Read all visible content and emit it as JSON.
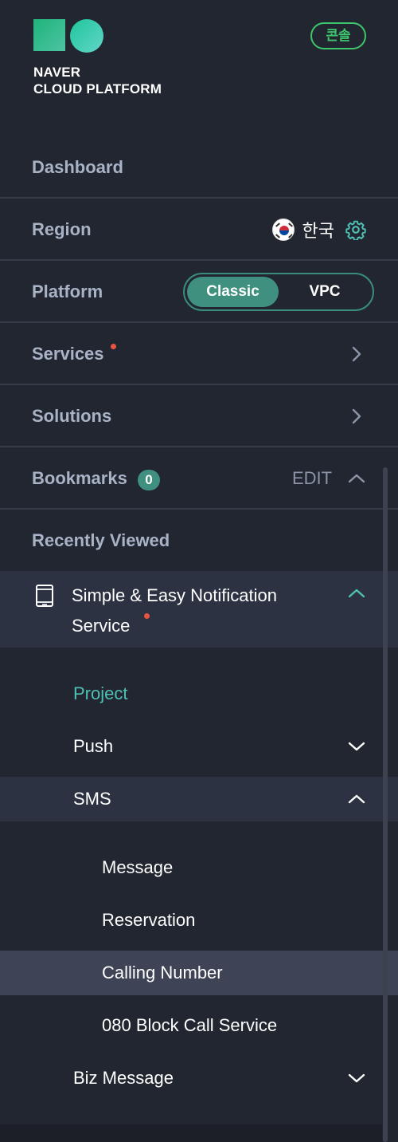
{
  "brand": {
    "line1": "NAVER",
    "line2": "CLOUD PLATFORM",
    "console_label": "콘솔",
    "accent": "#3ec66c"
  },
  "menu": {
    "dashboard": "Dashboard",
    "region": {
      "label": "Region",
      "value": "한국",
      "icon": "gear-icon"
    },
    "platform": {
      "label": "Platform",
      "options": [
        "Classic",
        "VPC"
      ],
      "selected": "Classic"
    },
    "services": {
      "label": "Services",
      "has_new": true
    },
    "solutions": {
      "label": "Solutions"
    },
    "bookmarks": {
      "label": "Bookmarks",
      "count": "0",
      "edit": "EDIT"
    },
    "recently_viewed": "Recently Viewed"
  },
  "service": {
    "title": "Simple & Easy Notification Service",
    "has_new": true,
    "items": {
      "project": "Project",
      "push": "Push",
      "sms": "SMS",
      "sms_children": [
        "Message",
        "Reservation",
        "Calling Number",
        "080 Block Call Service"
      ],
      "selected": "Calling Number",
      "biz_message": "Biz Message"
    }
  }
}
